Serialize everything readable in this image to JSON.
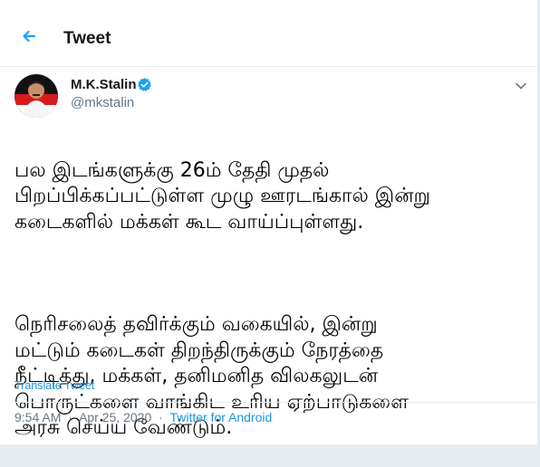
{
  "header": {
    "title": "Tweet",
    "back_icon": "back-arrow-icon"
  },
  "author": {
    "display_name": "M.K.Stalin",
    "handle": "@mkstalin",
    "verified": true,
    "verified_icon": "verified-badge-icon"
  },
  "tweet": {
    "paragraph1": "பல இடங்களுக்கு 26ம் தேதி முதல்\nபிறப்பிக்கப்பட்டுள்ள முழு ஊரடங்கால் இன்று\nகடைகளில் மக்கள் கூட வாய்ப்புள்ளது.",
    "paragraph2": "நெரிசலைத் தவிர்க்கும் வகையில், இன்று\nமட்டும் கடைகள் திறந்திருக்கும் நேரத்தை\nநீட்டித்து, மக்கள், தனிமனித விலகலுடன்\nபொருட்களை வாங்கிட உரிய ஏற்பாடுகளை\nஅரசு செய்ய வேண்டும்.",
    "translate_label": "Translate Tweet"
  },
  "meta": {
    "time": "9:54 AM",
    "date": "Apr 25, 2020",
    "source": "Twitter for Android",
    "separator": "·"
  },
  "colors": {
    "accent": "#1b95e0",
    "secondary_text": "#657786",
    "verified": "#1da1f2",
    "avatar_red": "#d7191c",
    "avatar_dark": "#111111"
  },
  "icons": {
    "menu": "chevron-down-icon"
  }
}
